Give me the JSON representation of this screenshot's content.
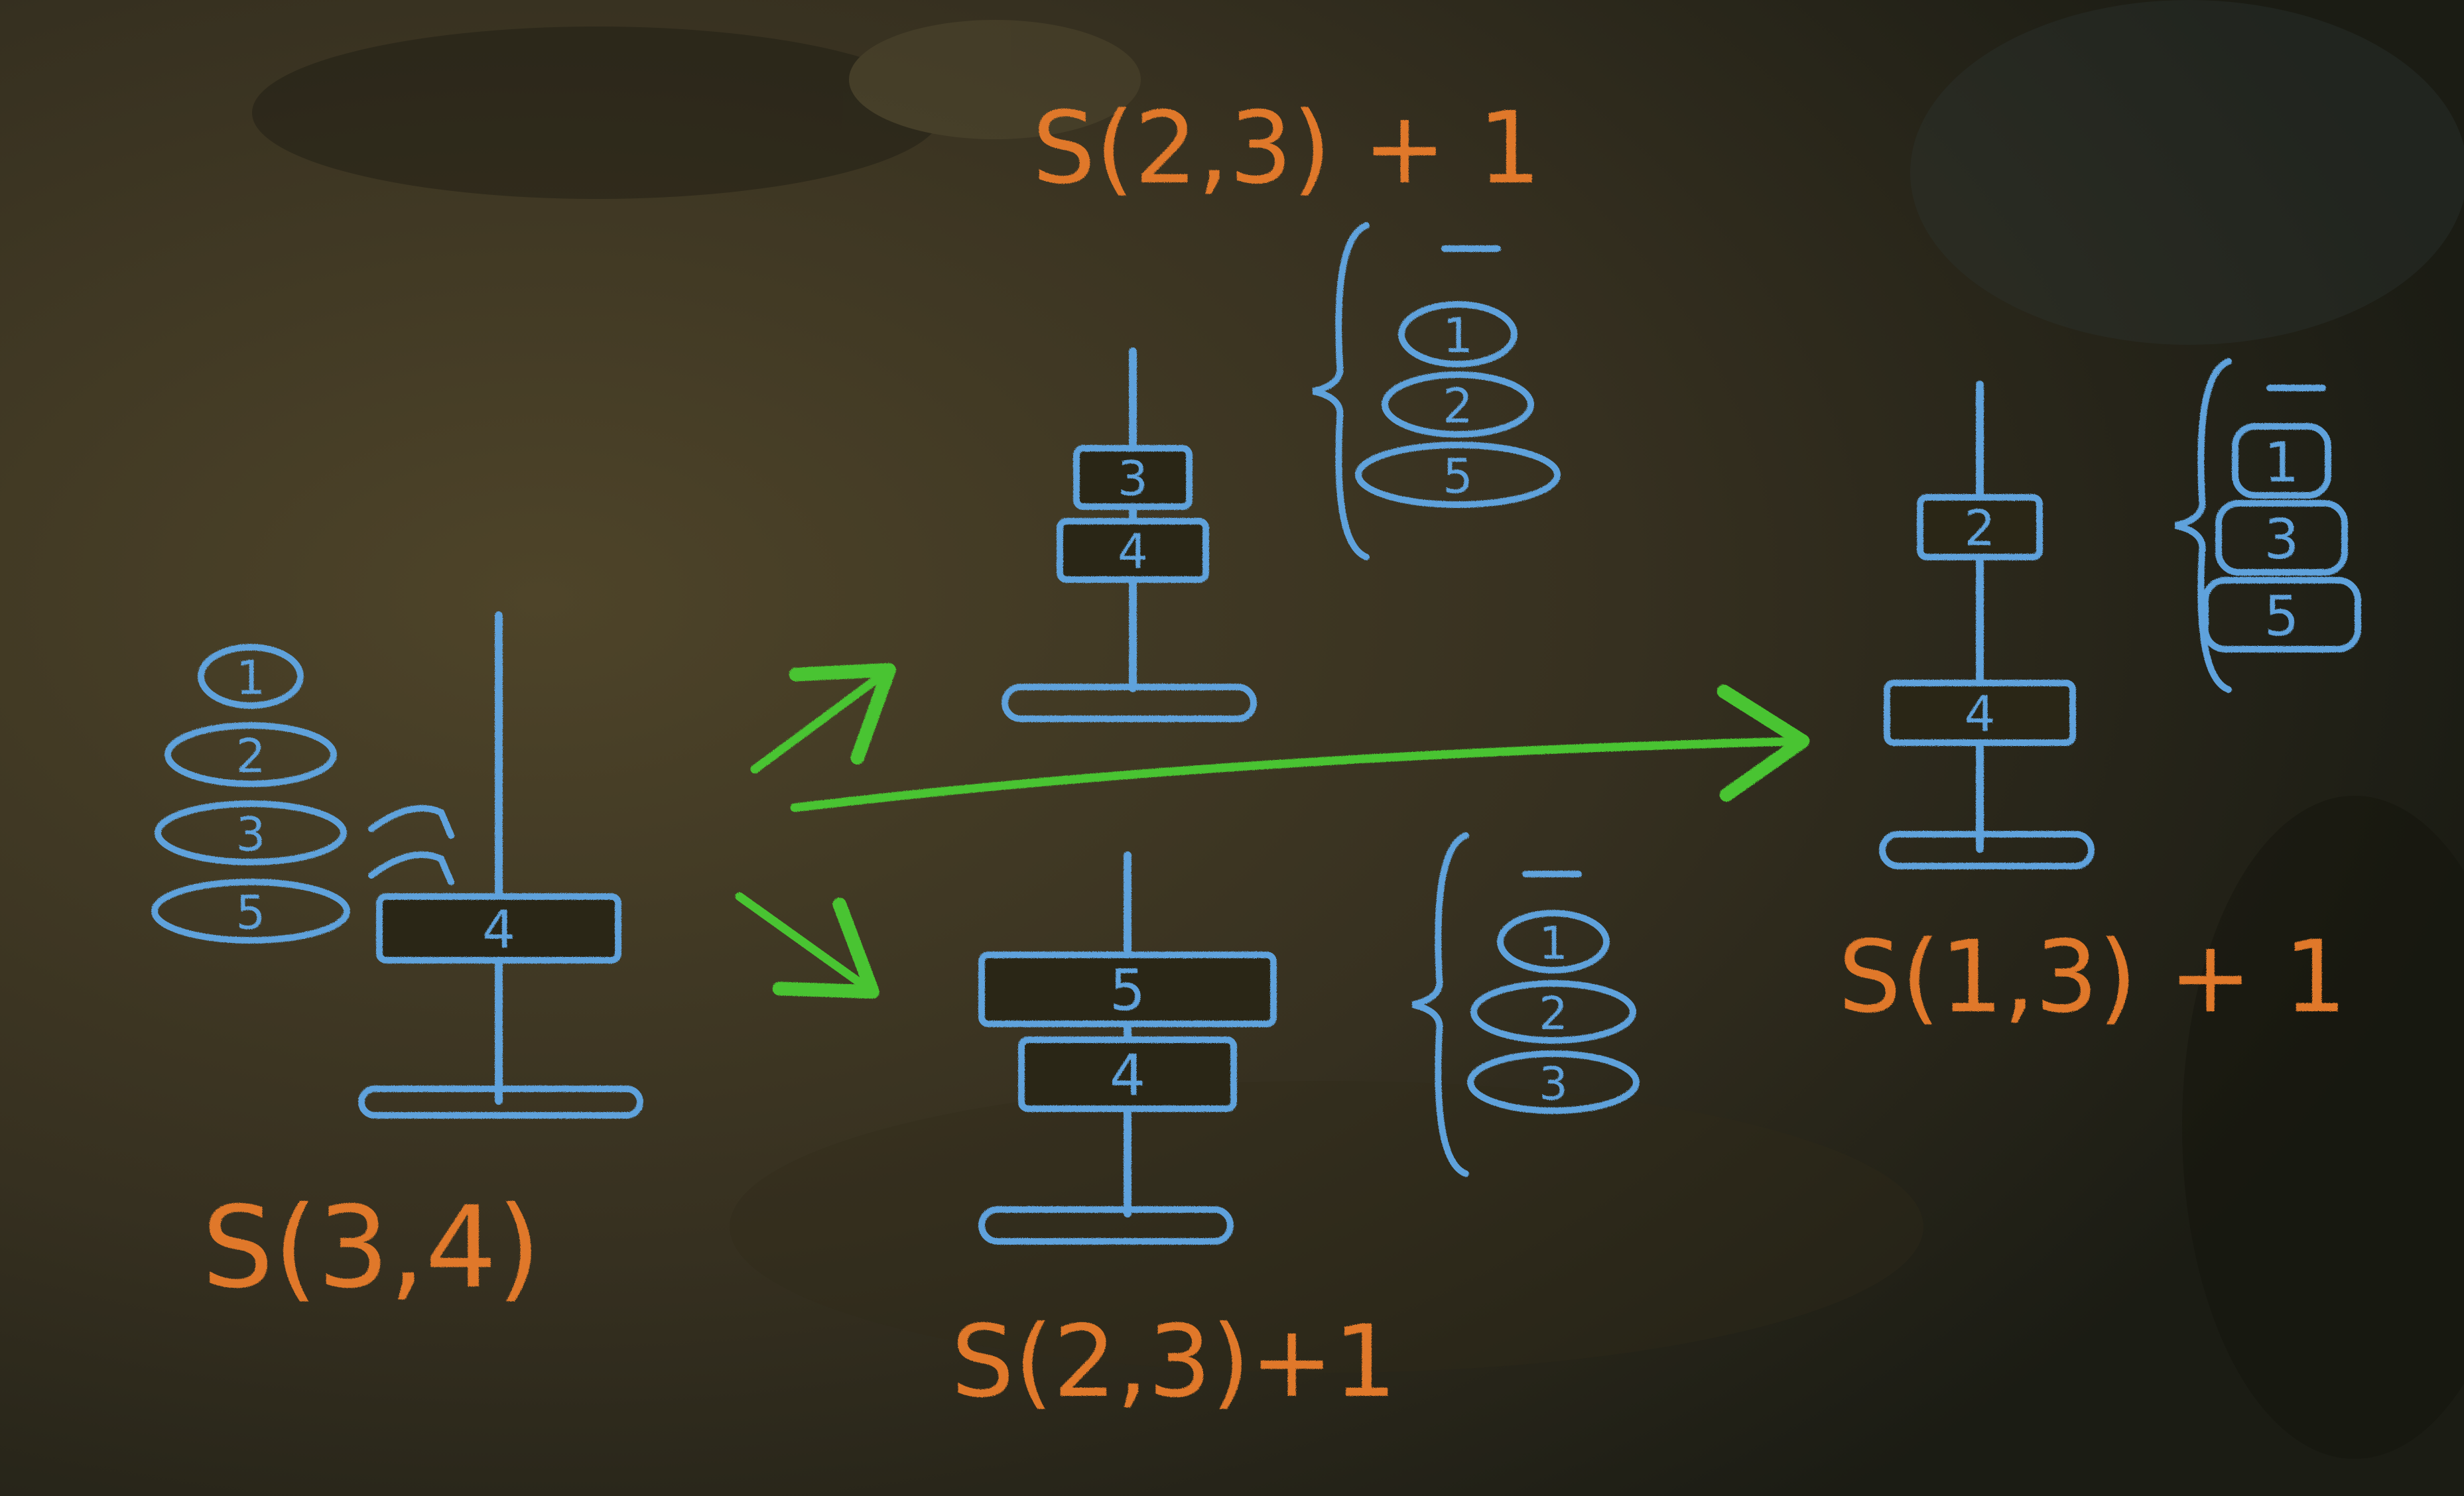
{
  "colors": {
    "board_light": "#4a4128",
    "board_dark": "#1c1d14",
    "chalk_blue": "#5ea2dc",
    "chalk_orange": "#e0782a",
    "chalk_green": "#49c431"
  },
  "labels": {
    "left": "S(3,4)",
    "top": "S(2,3) + 1",
    "bottom": "S(2,3)+1",
    "right": "S(1,3) + 1"
  },
  "states": {
    "left": {
      "pile": [
        "1",
        "2",
        "3",
        "5"
      ],
      "stack": [
        "4"
      ],
      "stack_mark": ""
    },
    "top": {
      "pile": [
        "1",
        "2",
        "5"
      ],
      "stack": [
        "3",
        "4"
      ],
      "stack_mark": ""
    },
    "bottom": {
      "pile": [
        "1",
        "2",
        "3"
      ],
      "stack": [
        "5",
        "4"
      ],
      "stack_mark": ""
    },
    "right": {
      "pile": [
        "1",
        "3",
        "5"
      ],
      "stack": [
        "2",
        "4"
      ],
      "stack_mark": ""
    }
  }
}
